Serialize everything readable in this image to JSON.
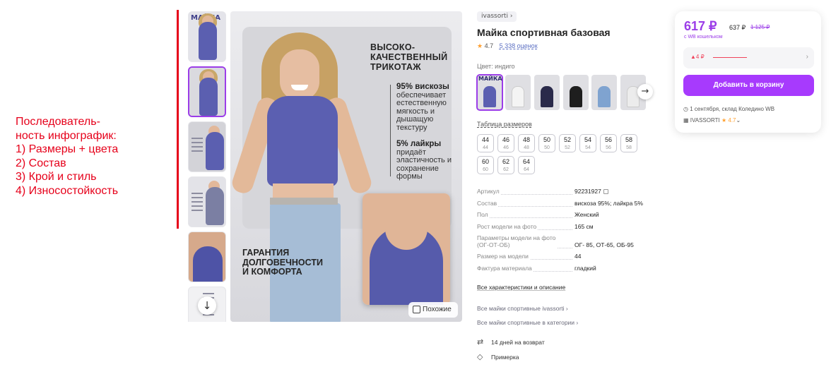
{
  "annotation": {
    "lines": [
      "Последователь-",
      "ность инфографик:",
      "1) Размеры + цвета",
      "2) Состав",
      "3) Крой и стиль",
      "4) Износостойкость"
    ]
  },
  "gallery": {
    "main_headline": "ВЫСОКО-\nКАЧЕСТВЕННЫЙ\nТРИКОТАЖ",
    "feature1_title": "95% вискозы",
    "feature1_text": "обеспечивает естественную мягкость и дышащую текстуру",
    "feature2_title": "5% лайкры",
    "feature2_text": "придаёт эластичность и сохранение формы",
    "bottom_headline": "ГАРАНТИЯ\nДОЛГОВЕЧНОСТИ\nИ КОМФОРТА",
    "similar_label": "Похожие",
    "thumb_brand": "МАЙКА"
  },
  "product": {
    "brand": "ivassorti",
    "title": "Майка спортивная базовая",
    "rating": "4.7",
    "reviews": "5 338 оценок",
    "color_label": "Цвет: индиго",
    "swatch_brand": "МАЙКА",
    "size_table_link": "Таблица размеров",
    "sizes": [
      {
        "n": "44",
        "s": "44"
      },
      {
        "n": "46",
        "s": "46"
      },
      {
        "n": "48",
        "s": "48"
      },
      {
        "n": "50",
        "s": "50"
      },
      {
        "n": "52",
        "s": "52"
      },
      {
        "n": "54",
        "s": "54"
      },
      {
        "n": "56",
        "s": "56"
      },
      {
        "n": "58",
        "s": "58"
      },
      {
        "n": "60",
        "s": "60"
      },
      {
        "n": "62",
        "s": "62"
      },
      {
        "n": "64",
        "s": "64"
      }
    ],
    "specs": [
      {
        "k": "Артикул",
        "v": "92231927"
      },
      {
        "k": "Состав",
        "v": "вискоза 95%; лайкра 5%"
      },
      {
        "k": "Пол",
        "v": "Женский"
      },
      {
        "k": "Рост модели на фото",
        "v": "165 см"
      },
      {
        "k": "Параметры модели на фото\n(ОГ-ОТ-ОБ)",
        "v": "ОГ- 85, ОТ-65, ОБ-95"
      },
      {
        "k": "Размер на модели",
        "v": "44"
      },
      {
        "k": "Фактура материала",
        "v": "гладкий"
      }
    ],
    "all_characteristics": "Все характеристики и описание",
    "link_brand": "Все майки спортивные ivassorti ›",
    "link_category": "Все майки спортивные в категории ›",
    "returns": "14 дней на возврат",
    "fitting": "Примерка"
  },
  "card": {
    "price": "617 ₽",
    "price_regular": "637 ₽",
    "price_old": "1 125 ₽",
    "wallet_note": "с WB кошельком",
    "price_change": "▲4 ₽",
    "add_to_cart": "Добавить в корзину",
    "delivery": "1 сентября, склад Коледино WB",
    "seller": "IVASSORTI",
    "seller_rating": "★ 4.7"
  },
  "colors": {
    "accent": "#9b3de8",
    "cart_button": "#a73afd",
    "annotation_red": "#e6001a",
    "price_up": "#f0435b",
    "rating_star": "#ff9f2e"
  }
}
